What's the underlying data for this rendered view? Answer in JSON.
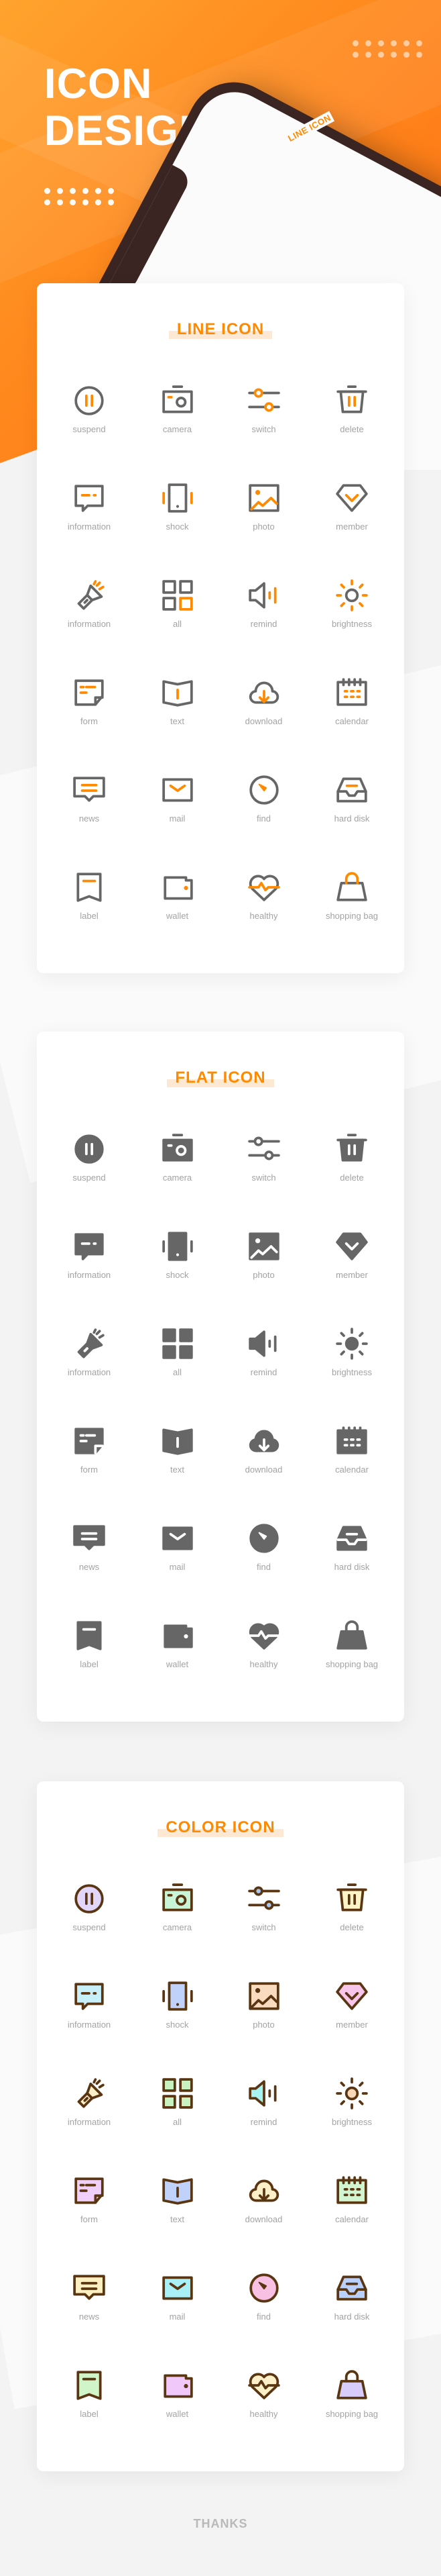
{
  "hero": {
    "title_line1": "ICON",
    "title_line2": "DESIGN",
    "phone_title": "LINE ICON"
  },
  "colors": {
    "accent": "#ff8a00",
    "line_gray": "#666666",
    "color_outline": "#5a3512",
    "highlight": "#fde8d3"
  },
  "cards": [
    {
      "title": "LINE ICON",
      "style": "line",
      "items": [
        {
          "label": "suspend",
          "icon": "suspend"
        },
        {
          "label": "camera",
          "icon": "camera"
        },
        {
          "label": "switch",
          "icon": "switch"
        },
        {
          "label": "delete",
          "icon": "delete"
        },
        {
          "label": "information",
          "icon": "information"
        },
        {
          "label": "shock",
          "icon": "shock"
        },
        {
          "label": "photo",
          "icon": "photo"
        },
        {
          "label": "member",
          "icon": "member"
        },
        {
          "label": "information",
          "icon": "flashlight"
        },
        {
          "label": "all",
          "icon": "all"
        },
        {
          "label": "remind",
          "icon": "remind"
        },
        {
          "label": "brightness",
          "icon": "brightness"
        },
        {
          "label": "form",
          "icon": "form"
        },
        {
          "label": "text",
          "icon": "text"
        },
        {
          "label": "download",
          "icon": "download"
        },
        {
          "label": "calendar",
          "icon": "calendar"
        },
        {
          "label": "news",
          "icon": "news"
        },
        {
          "label": "mail",
          "icon": "mail"
        },
        {
          "label": "find",
          "icon": "find"
        },
        {
          "label": "hard disk",
          "icon": "hard-disk"
        },
        {
          "label": "label",
          "icon": "label"
        },
        {
          "label": "wallet",
          "icon": "wallet"
        },
        {
          "label": "healthy",
          "icon": "healthy"
        },
        {
          "label": "shopping bag",
          "icon": "shopping-bag"
        }
      ]
    },
    {
      "title": "FLAT ICON",
      "style": "flat",
      "items": [
        {
          "label": "suspend",
          "icon": "suspend"
        },
        {
          "label": "camera",
          "icon": "camera"
        },
        {
          "label": "switch",
          "icon": "switch"
        },
        {
          "label": "delete",
          "icon": "delete"
        },
        {
          "label": "information",
          "icon": "information"
        },
        {
          "label": "shock",
          "icon": "shock"
        },
        {
          "label": "photo",
          "icon": "photo"
        },
        {
          "label": "member",
          "icon": "member"
        },
        {
          "label": "information",
          "icon": "flashlight"
        },
        {
          "label": "all",
          "icon": "all"
        },
        {
          "label": "remind",
          "icon": "remind"
        },
        {
          "label": "brightness",
          "icon": "brightness"
        },
        {
          "label": "form",
          "icon": "form"
        },
        {
          "label": "text",
          "icon": "text"
        },
        {
          "label": "download",
          "icon": "download"
        },
        {
          "label": "calendar",
          "icon": "calendar"
        },
        {
          "label": "news",
          "icon": "news"
        },
        {
          "label": "mail",
          "icon": "mail"
        },
        {
          "label": "find",
          "icon": "find"
        },
        {
          "label": "hard disk",
          "icon": "hard-disk"
        },
        {
          "label": "label",
          "icon": "label"
        },
        {
          "label": "wallet",
          "icon": "wallet"
        },
        {
          "label": "healthy",
          "icon": "healthy"
        },
        {
          "label": "shopping bag",
          "icon": "shopping-bag"
        }
      ]
    },
    {
      "title": "COLOR ICON",
      "style": "color",
      "items": [
        {
          "label": "suspend",
          "icon": "suspend",
          "color": "#e2d6fa"
        },
        {
          "label": "camera",
          "icon": "camera",
          "color": "#c8f5d6"
        },
        {
          "label": "switch",
          "icon": "switch",
          "color": "#a8c8f2"
        },
        {
          "label": "delete",
          "icon": "delete",
          "color": "#fdf5c8"
        },
        {
          "label": "information",
          "icon": "information",
          "color": "#c8f0fa"
        },
        {
          "label": "shock",
          "icon": "shock",
          "color": "#c0d2fa"
        },
        {
          "label": "photo",
          "icon": "photo",
          "color": "#f9dcc0"
        },
        {
          "label": "member",
          "icon": "member",
          "color": "#f8c6ea"
        },
        {
          "label": "information",
          "icon": "flashlight",
          "color": "#fdf0c8"
        },
        {
          "label": "all",
          "icon": "all",
          "color": "#c8f2c0"
        },
        {
          "label": "remind",
          "icon": "remind",
          "color": "#a8f2f2"
        },
        {
          "label": "brightness",
          "icon": "brightness",
          "color": "#f9d8b8"
        },
        {
          "label": "form",
          "icon": "form",
          "color": "#f0d0fa"
        },
        {
          "label": "text",
          "icon": "text",
          "color": "#c0d2fa"
        },
        {
          "label": "download",
          "icon": "download",
          "color": "#fdf0c8"
        },
        {
          "label": "calendar",
          "icon": "calendar",
          "color": "#d0f5d0"
        },
        {
          "label": "news",
          "icon": "news",
          "color": "#fdf0c0"
        },
        {
          "label": "mail",
          "icon": "mail",
          "color": "#a8f0f5"
        },
        {
          "label": "find",
          "icon": "find",
          "color": "#f8c0e2"
        },
        {
          "label": "hard disk",
          "icon": "hard-disk",
          "color": "#b8d0fa"
        },
        {
          "label": "label",
          "icon": "label",
          "color": "#d0f5c8"
        },
        {
          "label": "wallet",
          "icon": "wallet",
          "color": "#f0c8fa"
        },
        {
          "label": "healthy",
          "icon": "healthy",
          "color": "#fdf0c8"
        },
        {
          "label": "shopping bag",
          "icon": "shopping-bag",
          "color": "#d8ccfa"
        }
      ]
    }
  ],
  "footer": {
    "thanks": "THANKS"
  }
}
